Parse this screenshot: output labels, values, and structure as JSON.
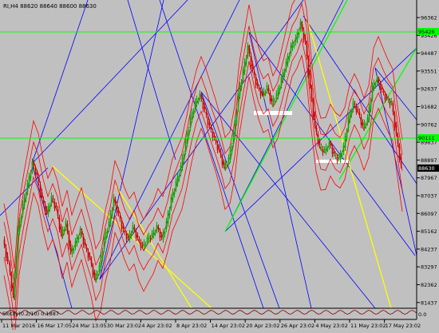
{
  "header": {
    "symbol_line": "RI,H4  88620 88640 88600 88630"
  },
  "price_axis": {
    "ticks": [
      "96362",
      "95426",
      "94487",
      "93551",
      "92637",
      "91682",
      "90762",
      "89837",
      "88897",
      "87967",
      "87037",
      "86097",
      "85162",
      "84237",
      "83297",
      "82362",
      "81437"
    ],
    "current_price": "88630",
    "level_upper": "95426",
    "level_lower": "90111"
  },
  "time_axis": {
    "ticks": [
      "11 Mar 2016",
      "16 Mar 17:05",
      "24 Mar 13:05",
      "30 Mar 23:02",
      "4 Apr 23:02",
      "8 Apr 23:02",
      "14 Apr 23:02",
      "20 Apr 23:02",
      "26 Apr 23:02",
      "4 May 23:02",
      "11 May 23:02",
      "17 May 23:02"
    ]
  },
  "indicator": {
    "label": "Slotify(0.2/10) 0.1887",
    "axis_value": "0.0"
  },
  "colors": {
    "background": "#c0c0c0",
    "candle_bull": "#00aa00",
    "candle_bear": "#cc0000",
    "bands": "#ff0000",
    "fan_lines": "#0000ff",
    "trend_yellow": "#ffff00",
    "trend_green": "#00ff00",
    "price_label_bg": "#000000"
  }
}
